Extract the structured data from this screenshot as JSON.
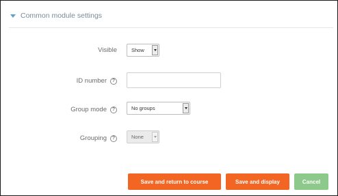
{
  "section": {
    "title": "Common module settings"
  },
  "fields": {
    "visible": {
      "label": "Visible",
      "value": "Show"
    },
    "id_number": {
      "label": "ID number",
      "value": ""
    },
    "group_mode": {
      "label": "Group mode",
      "value": "No groups"
    },
    "grouping": {
      "label": "Grouping",
      "value": "None"
    }
  },
  "help_glyph": "?",
  "buttons": {
    "save_return": "Save and return to course",
    "save_display": "Save and display",
    "cancel": "Cancel"
  },
  "colors": {
    "primary_button": "#f26522",
    "cancel_button": "#8dc98a",
    "section_caret": "#5aa3c7"
  }
}
